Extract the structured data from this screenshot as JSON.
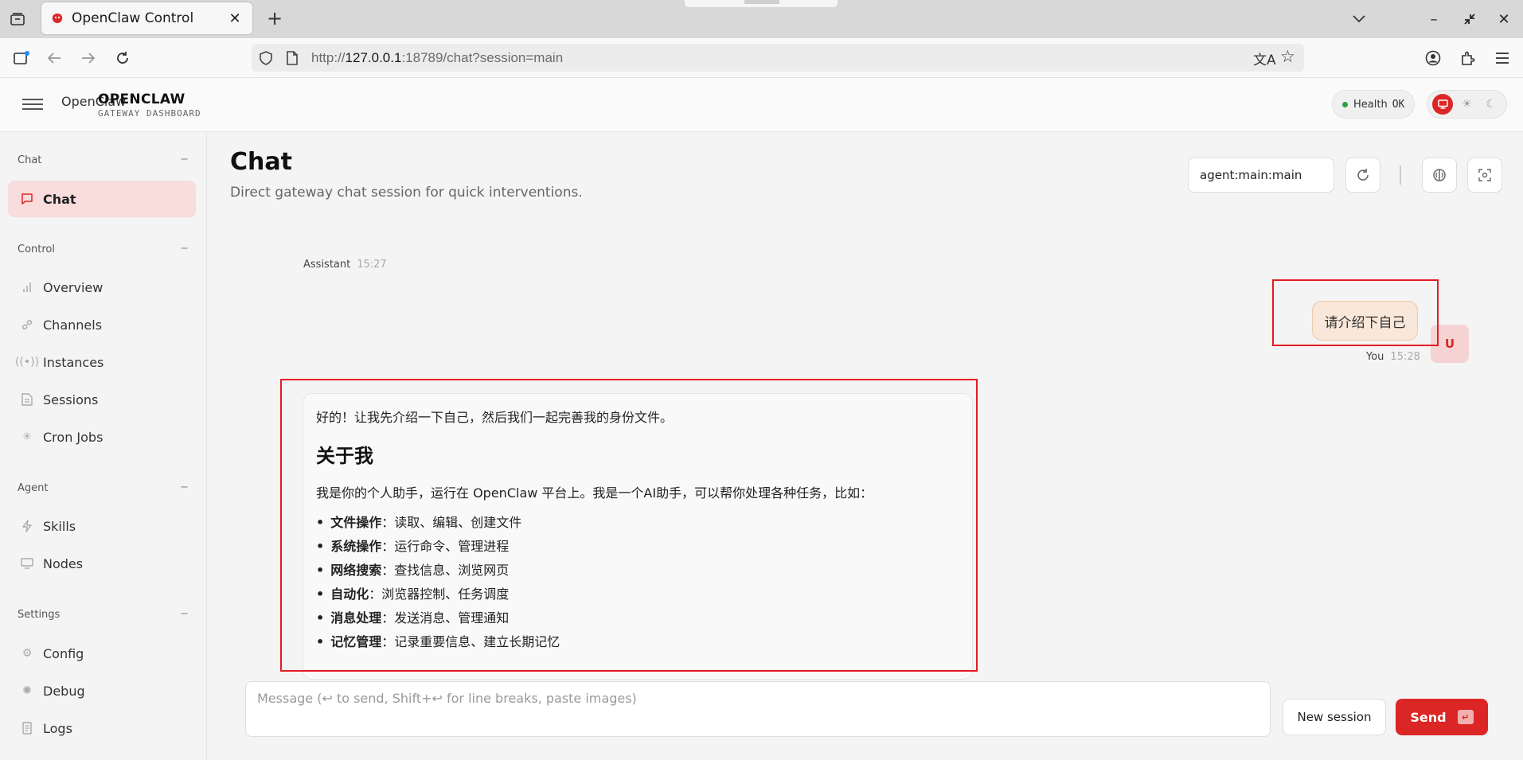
{
  "browser": {
    "tab_title": "OpenClaw Control",
    "url_prefix": "http://",
    "url_host": "127.0.0.1",
    "url_rest": ":18789/chat?session=main"
  },
  "header": {
    "brand_alt": "OpenClaw",
    "brand_title": "OPENCLAW",
    "brand_subtitle": "GATEWAY DASHBOARD",
    "health_label": "Health",
    "health_value": "OK"
  },
  "sidebar": {
    "groups": [
      {
        "label": "Chat",
        "collapse": "−"
      },
      {
        "label": "Control",
        "collapse": "−"
      },
      {
        "label": "Agent",
        "collapse": "−"
      },
      {
        "label": "Settings",
        "collapse": "−"
      }
    ],
    "items": [
      {
        "label": "Chat",
        "icon": "message-icon"
      },
      {
        "label": "Overview",
        "icon": "bar-chart-icon"
      },
      {
        "label": "Channels",
        "icon": "link-icon"
      },
      {
        "label": "Instances",
        "icon": "radio-icon"
      },
      {
        "label": "Sessions",
        "icon": "file-icon"
      },
      {
        "label": "Cron Jobs",
        "icon": "loader-icon"
      },
      {
        "label": "Skills",
        "icon": "zap-icon"
      },
      {
        "label": "Nodes",
        "icon": "monitor-icon"
      },
      {
        "label": "Config",
        "icon": "gear-icon"
      },
      {
        "label": "Debug",
        "icon": "bug-icon"
      },
      {
        "label": "Logs",
        "icon": "scroll-icon"
      }
    ]
  },
  "main": {
    "title": "Chat",
    "subtitle": "Direct gateway chat session for quick interventions.",
    "session_value": "agent:main:main"
  },
  "messages": {
    "previous_role": "Assistant",
    "previous_time": "15:27",
    "user_text": "请介绍下自己",
    "user_avatar": "U",
    "user_role": "You",
    "user_time": "15:28",
    "assistant_intro": "好的！让我先介绍一下自己，然后我们一起完善我的身份文件。",
    "assistant_heading": "关于我",
    "assistant_para": "我是你的个人助手，运行在 OpenClaw 平台上。我是一个AI助手，可以帮你处理各种任务，比如：",
    "assistant_list": [
      {
        "bold": "文件操作",
        "text": "：读取、编辑、创建文件"
      },
      {
        "bold": "系统操作",
        "text": "：运行命令、管理进程"
      },
      {
        "bold": "网络搜索",
        "text": "：查找信息、浏览网页"
      },
      {
        "bold": "自动化",
        "text": "：浏览器控制、任务调度"
      },
      {
        "bold": "消息处理",
        "text": "：发送消息、管理通知"
      },
      {
        "bold": "记忆管理",
        "text": "：记录重要信息、建立长期记忆"
      }
    ]
  },
  "composer": {
    "placeholder": "Message (↩ to send, Shift+↩ for line breaks, paste images)",
    "new_session_label": "New session",
    "send_label": "Send",
    "send_kbd": "↵"
  },
  "colors": {
    "accent": "#dc2626",
    "highlight_box": "#e31b23",
    "health_dot": "#2ea043"
  }
}
